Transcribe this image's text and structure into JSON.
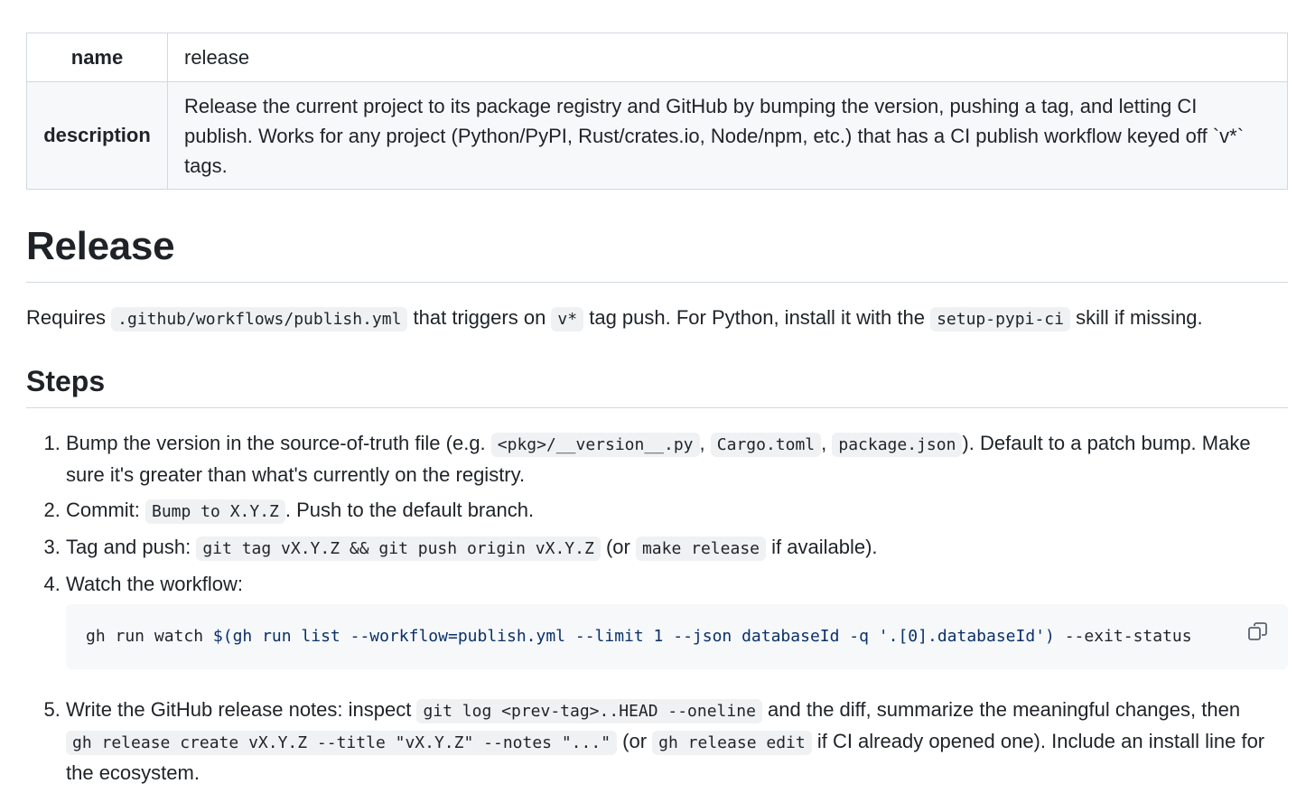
{
  "front_matter": {
    "name_key": "name",
    "name_value": "release",
    "description_key": "description",
    "description_value": "Release the current project to its package registry and GitHub by bumping the version, pushing a tag, and letting CI publish. Works for any project (Python/PyPI, Rust/crates.io, Node/npm, etc.) that has a CI publish workflow keyed off `v*` tags."
  },
  "title": "Release",
  "requirements": {
    "t1": "Requires ",
    "c1": ".github/workflows/publish.yml",
    "t2": " that triggers on ",
    "c2": "v*",
    "t3": " tag push. For Python, install it with the ",
    "c3": "setup-pypi-ci",
    "t4": " skill if missing."
  },
  "steps_heading": "Steps",
  "steps": [
    {
      "t1": "Bump the version in the source-of-truth file (e.g. ",
      "c1": "<pkg>/__version__.py",
      "t2": ", ",
      "c2": "Cargo.toml",
      "t3": ", ",
      "c3": "package.json",
      "t4": "). Default to a patch bump. Make sure it's greater than what's currently on the registry."
    },
    {
      "t1": "Commit: ",
      "c1": "Bump to X.Y.Z",
      "t2": ". Push to the default branch."
    },
    {
      "t1": "Tag and push: ",
      "c1": "git tag vX.Y.Z && git push origin vX.Y.Z",
      "t2": " (or ",
      "c2": "make release",
      "t3": " if available)."
    },
    {
      "t1": "Watch the workflow:",
      "code_a": "gh run watch ",
      "code_b": "$(gh run list --workflow=publish.yml --limit 1 --json databaseId -q '.[0].databaseId')",
      "code_c": " --exit-status"
    },
    {
      "t1": "Write the GitHub release notes: inspect ",
      "c1": "git log <prev-tag>..HEAD --oneline",
      "t2": " and the diff, summarize the meaningful changes, then ",
      "c2": "gh release create vX.Y.Z --title \"vX.Y.Z\" --notes \"...\"",
      "t3": " (or ",
      "c3": "gh release edit",
      "t4": " if CI already opened one). Include an install line for the ecosystem."
    }
  ],
  "icons": {
    "copy": "copy-icon"
  }
}
